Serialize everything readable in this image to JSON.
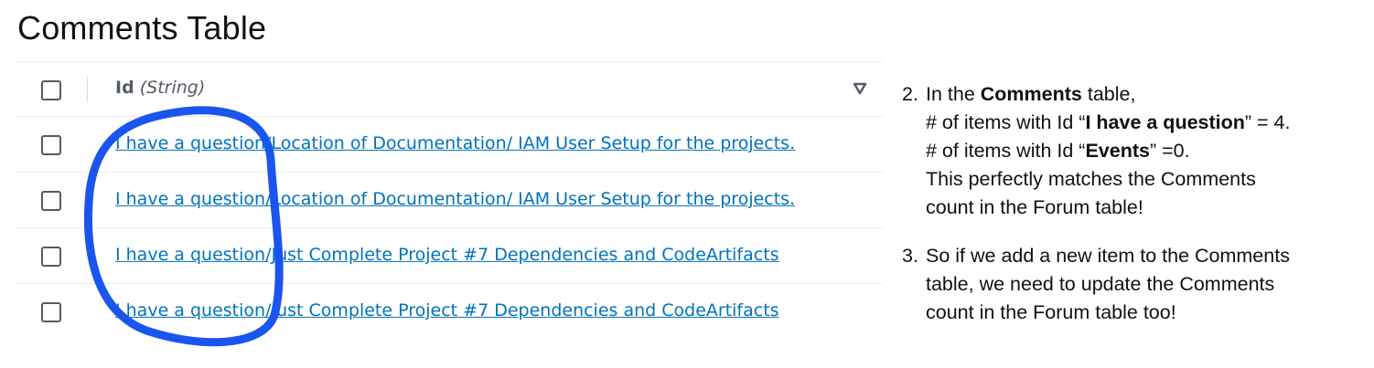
{
  "page_title": "Comments Table",
  "table": {
    "column": {
      "name": "Id",
      "type": "(String)"
    },
    "rows": [
      {
        "id": "I have a question/Location of Documentation/ IAM User Setup for the projects."
      },
      {
        "id": "I have a question/Location of Documentation/ IAM User Setup for the projects."
      },
      {
        "id": "I have a question/Just Complete Project #7 Dependencies and CodeArtifacts"
      },
      {
        "id": "I have a question/Just Complete Project #7 Dependencies and CodeArtifacts"
      }
    ]
  },
  "notes": {
    "note1": {
      "number": "2.",
      "l1_pre": "In the ",
      "l1_bold": "Comments",
      "l1_post": " table,",
      "l2_pre": "# of items with Id “",
      "l2_bold": "I have a question",
      "l2_post": "” = 4.",
      "l3_pre": "# of items with Id “",
      "l3_bold": "Events",
      "l3_post": "” =0.",
      "l4": "This perfectly matches the Comments",
      "l5": "count in the Forum table!"
    },
    "note2": {
      "number": "3.",
      "l1": "So if we add a new item to the Comments",
      "l2": "table, we need to update the Comments",
      "l3": "count in the Forum table too!"
    }
  },
  "colors": {
    "link": "#0073bb",
    "highlight_stroke": "#1a55f0"
  }
}
